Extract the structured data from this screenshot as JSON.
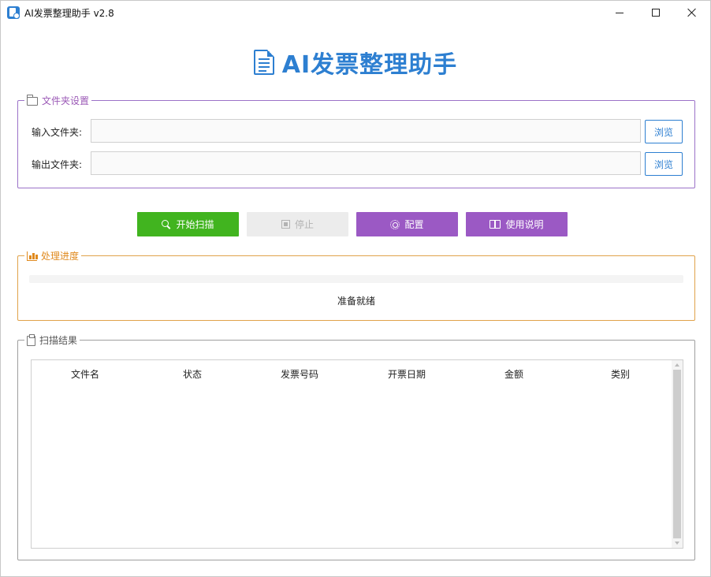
{
  "window": {
    "title": "AI发票整理助手 v2.8"
  },
  "heading": {
    "title": "AI发票整理助手",
    "icon": "document-icon",
    "color": "#2d7fd1"
  },
  "folder_settings": {
    "legend": "文件夹设置",
    "input_label": "输入文件夹:",
    "input_value": "",
    "output_label": "输出文件夹:",
    "output_value": "",
    "browse_label": "浏览"
  },
  "actions": {
    "start_label": "开始扫描",
    "stop_label": "停止",
    "config_label": "配置",
    "help_label": "使用说明",
    "start_color": "#41b41f",
    "purple_color": "#9b59c4"
  },
  "progress": {
    "legend": "处理进度",
    "value_percent": 0,
    "status": "准备就绪"
  },
  "results": {
    "legend": "扫描结果",
    "columns": [
      "文件名",
      "状态",
      "发票号码",
      "开票日期",
      "金额",
      "类别"
    ],
    "rows": []
  }
}
